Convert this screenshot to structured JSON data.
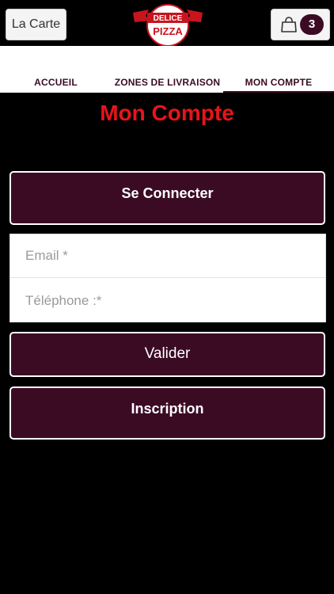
{
  "header": {
    "menu_label": "La Carte",
    "logo_line1": "DELICE",
    "logo_line2": "PIZZA",
    "cart_count": "3"
  },
  "tabs": [
    {
      "label": "ACCUEIL"
    },
    {
      "label": "ZONES DE LIVRAISON"
    },
    {
      "label": "MON COMPTE",
      "active": true
    }
  ],
  "main": {
    "title": "Mon Compte",
    "connect_label": "Se Connecter",
    "email_placeholder": "Email *",
    "phone_placeholder": "Téléphone :*",
    "submit_label": "Valider",
    "signup_label": "Inscription"
  },
  "colors": {
    "accent": "#3b0b24",
    "title_red": "#e8141b",
    "background": "#000000"
  }
}
